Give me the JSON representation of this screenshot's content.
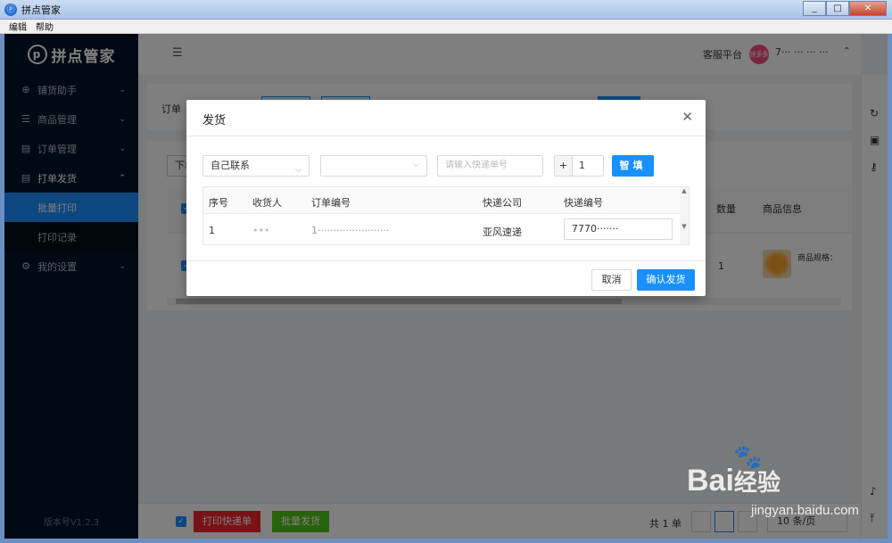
{
  "window": {
    "title": "拼点管家",
    "app_icon": "ⓟ",
    "minimize": "_",
    "maximize": "□",
    "close": "✕"
  },
  "menubar": [
    "编辑",
    "帮助"
  ],
  "sidebar": {
    "logo": "拼点管家",
    "logo_mark": "p",
    "items": [
      {
        "label": "铺货助手",
        "icon": "⊕"
      },
      {
        "label": "商品管理",
        "icon": "☰"
      },
      {
        "label": "订单管理",
        "icon": "▤"
      },
      {
        "label": "打单发货",
        "icon": "▤"
      },
      {
        "label": "我的设置",
        "icon": "⚙"
      }
    ],
    "subitems": [
      "批量打印",
      "打印记录"
    ],
    "version": "版本号V1.2.3"
  },
  "topbar": {
    "service": "客服平台",
    "username": "7··· ··· ··· ···",
    "avatar_text": "拼多多"
  },
  "filter": {
    "label": "订单"
  },
  "table": {
    "download": "下单",
    "quantity_header": "数量",
    "goods_header": "商品信息",
    "quantity_value": "1",
    "spec": "商品规格："
  },
  "footer": {
    "print": "打印快递单",
    "batch": "批量发货",
    "total": "共 1 单",
    "pagesize": "10 条/页"
  },
  "modal": {
    "title": "发货",
    "close": "✕",
    "contact_select": "自己联系",
    "tracking_placeholder": "请输入快递单号",
    "stepper_value": "1",
    "stepper_plus": "+",
    "smart_fill": "智填",
    "columns": [
      "序号",
      "收货人",
      "订单编号",
      "快递公司",
      "快递编号"
    ],
    "rows": [
      {
        "index": "1",
        "receiver": "•••",
        "order_no": "1·······················",
        "courier": "亚风速递",
        "tracking": "7770·······"
      }
    ],
    "cancel": "取消",
    "confirm": "确认发货"
  },
  "watermark": {
    "brand": "Bai",
    "brand_suffix": "经验",
    "url": "jingyan.baidu.com"
  }
}
